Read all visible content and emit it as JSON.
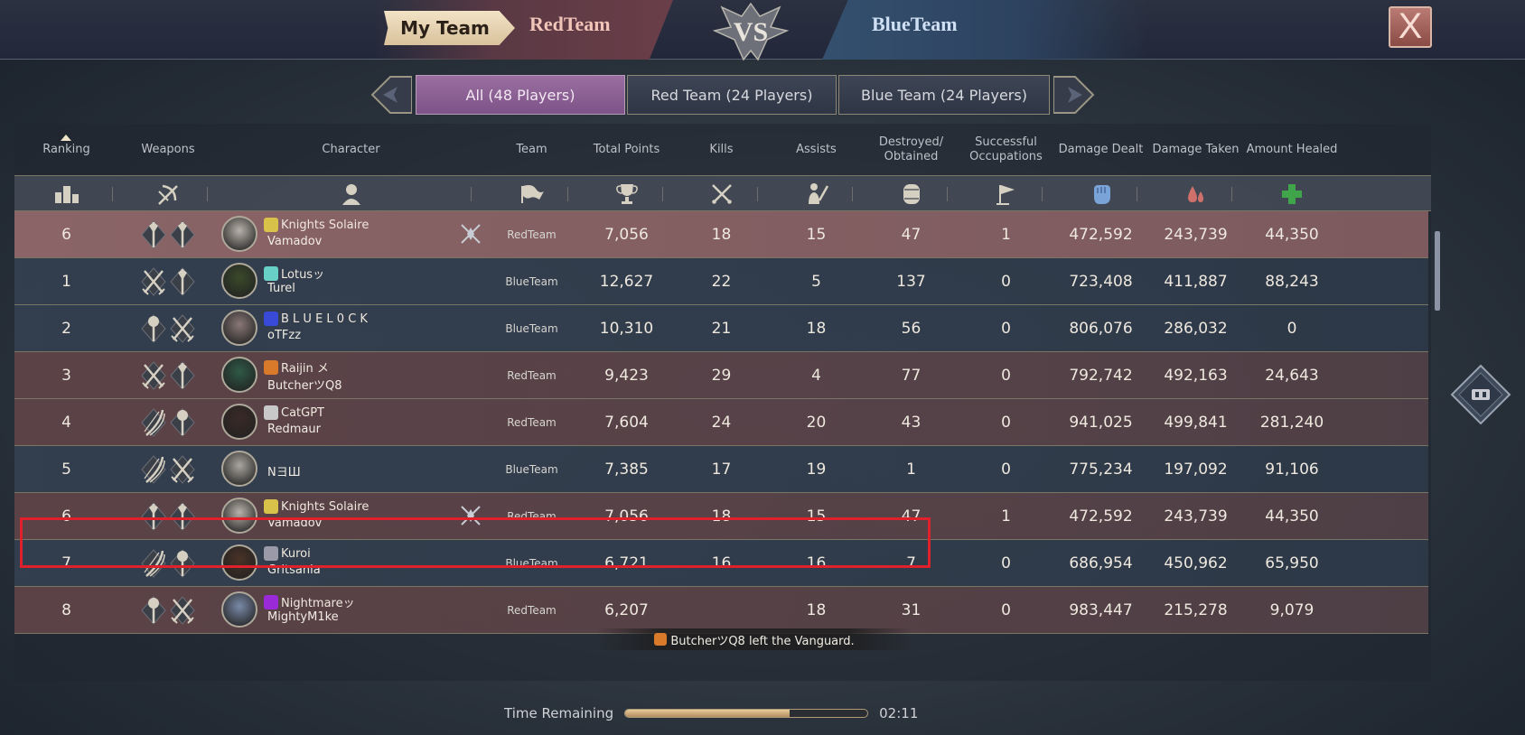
{
  "header": {
    "my_team_label": "My Team",
    "red_team": "RedTeam",
    "vs_label": "VS",
    "blue_team": "BlueTeam",
    "close_label": "X"
  },
  "tabs": [
    {
      "label": "All (48 Players)",
      "active": true
    },
    {
      "label": "Red Team (24 Players)",
      "active": false
    },
    {
      "label": "Blue Team (24 Players)",
      "active": false
    }
  ],
  "columns": {
    "ranking": "Ranking",
    "weapons": "Weapons",
    "character": "Character",
    "team": "Team",
    "total_points": "Total Points",
    "kills": "Kills",
    "assists": "Assists",
    "destroyed": "Destroyed/\nObtained",
    "occupations": "Successful\nOccupations",
    "damage_dealt": "Damage Dealt",
    "damage_taken": "Damage Taken",
    "amount_healed": "Amount Healed"
  },
  "rows": [
    {
      "rank": "6",
      "guild": "Knights Solaire",
      "name": "Vamadov",
      "team": "RedTeam",
      "points": "7,056",
      "kills": "18",
      "assists": "15",
      "destroyed": "47",
      "occupations": "1",
      "dealt": "472,592",
      "taken": "243,739",
      "healed": "44,350",
      "side": "me",
      "guild_color": "#d8c24a",
      "weapons": [
        "staff",
        "staff"
      ],
      "avatar_color": "#b8b2aa"
    },
    {
      "rank": "1",
      "guild": "Lotusッ",
      "name": "Turel",
      "team": "BlueTeam",
      "points": "12,627",
      "kills": "22",
      "assists": "5",
      "destroyed": "137",
      "occupations": "0",
      "dealt": "723,408",
      "taken": "411,887",
      "healed": "88,243",
      "side": "blue",
      "guild_color": "#69d0c8",
      "weapons": [
        "swords",
        "staff"
      ],
      "avatar_color": "#3a4a2a"
    },
    {
      "rank": "2",
      "guild": "B L U E L 0 C K",
      "name": "oTFzz",
      "team": "BlueTeam",
      "points": "10,310",
      "kills": "21",
      "assists": "18",
      "destroyed": "56",
      "occupations": "0",
      "dealt": "806,076",
      "taken": "286,032",
      "healed": "0",
      "side": "blue",
      "guild_color": "#3a4ad8",
      "weapons": [
        "mace",
        "swords"
      ],
      "avatar_color": "#8a7878"
    },
    {
      "rank": "3",
      "guild": "Raijin メ",
      "name": "ButcherツQ8",
      "team": "RedTeam",
      "points": "9,423",
      "kills": "29",
      "assists": "4",
      "destroyed": "77",
      "occupations": "0",
      "dealt": "792,742",
      "taken": "492,163",
      "healed": "24,643",
      "side": "red",
      "guild_color": "#d87a2a",
      "weapons": [
        "swords",
        "staff"
      ],
      "avatar_color": "#2f5a48"
    },
    {
      "rank": "4",
      "guild": "CatGPT",
      "name": "Redmaur",
      "team": "RedTeam",
      "points": "7,604",
      "kills": "24",
      "assists": "20",
      "destroyed": "43",
      "occupations": "0",
      "dealt": "941,025",
      "taken": "499,841",
      "healed": "281,240",
      "side": "red",
      "guild_color": "#c8c8c8",
      "weapons": [
        "bow",
        "mace"
      ],
      "avatar_color": "#3a2a26"
    },
    {
      "rank": "5",
      "guild": "",
      "name": "NヨШ",
      "team": "BlueTeam",
      "points": "7,385",
      "kills": "17",
      "assists": "19",
      "destroyed": "1",
      "occupations": "0",
      "dealt": "775,234",
      "taken": "197,092",
      "healed": "91,106",
      "side": "blue",
      "guild_color": "",
      "weapons": [
        "bow",
        "swords"
      ],
      "avatar_color": "#aaa6a0"
    },
    {
      "rank": "6",
      "guild": "Knights Solaire",
      "name": "Vamadov",
      "team": "RedTeam",
      "points": "7,056",
      "kills": "18",
      "assists": "15",
      "destroyed": "47",
      "occupations": "1",
      "dealt": "472,592",
      "taken": "243,739",
      "healed": "44,350",
      "side": "red",
      "guild_color": "#d8c24a",
      "weapons": [
        "staff",
        "staff"
      ],
      "avatar_color": "#b8b2aa"
    },
    {
      "rank": "7",
      "guild": "Kuroi",
      "name": "Gritsania",
      "team": "BlueTeam",
      "points": "6,721",
      "kills": "16",
      "assists": "16",
      "destroyed": "7",
      "occupations": "0",
      "dealt": "686,954",
      "taken": "450,962",
      "healed": "65,950",
      "side": "blue",
      "guild_color": "#9a9aa8",
      "weapons": [
        "bow",
        "mace"
      ],
      "avatar_color": "#4a3226"
    },
    {
      "rank": "8",
      "guild": "Nightmareッ",
      "name": "MightyM1ke",
      "team": "RedTeam",
      "points": "6,207",
      "kills": "",
      "assists": "18",
      "destroyed": "31",
      "occupations": "0",
      "dealt": "983,447",
      "taken": "215,278",
      "healed": "9,079",
      "side": "red",
      "guild_color": "#9a2ad8",
      "weapons": [
        "mace",
        "swords"
      ],
      "avatar_color": "#7a8aa8"
    }
  ],
  "toast": {
    "text": "ButcherツQ8 left the Vanguard."
  },
  "timer": {
    "label": "Time Remaining",
    "value": "02:11",
    "progress": 0.68
  },
  "colors": {
    "accent_active_tab": "#8d6396",
    "highlight_box": "#e0202a",
    "heal_icon": "#3fa44a",
    "damage_dealt_icon": "#7aa4d8",
    "damage_taken_icon": "#d0706a"
  }
}
